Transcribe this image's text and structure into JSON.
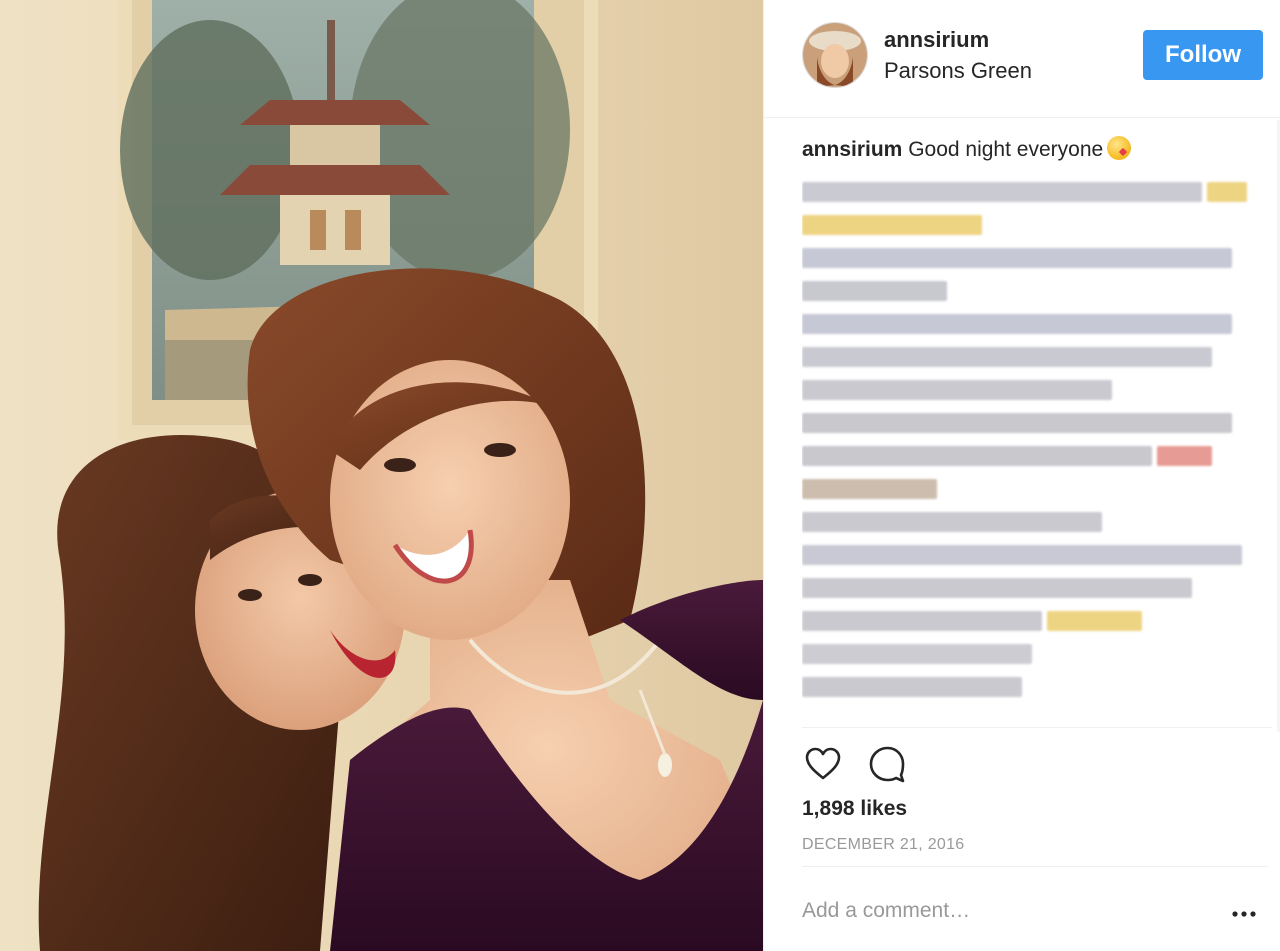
{
  "post": {
    "username": "annsirium",
    "location": "Parsons Green",
    "follow_label": "Follow",
    "caption_username": "annsirium",
    "caption_text": "Good night everyone",
    "likes": "1,898 likes",
    "date": "DECEMBER 21, 2016",
    "comment_placeholder": "Add a comment…"
  },
  "icons": [
    "heart-icon",
    "comment-bubble-icon",
    "more-options-icon",
    "kiss-emoji-icon"
  ],
  "colors": {
    "follow_button": "#3897f0",
    "text": "#262626",
    "muted": "#999999",
    "divider": "#efefef"
  }
}
